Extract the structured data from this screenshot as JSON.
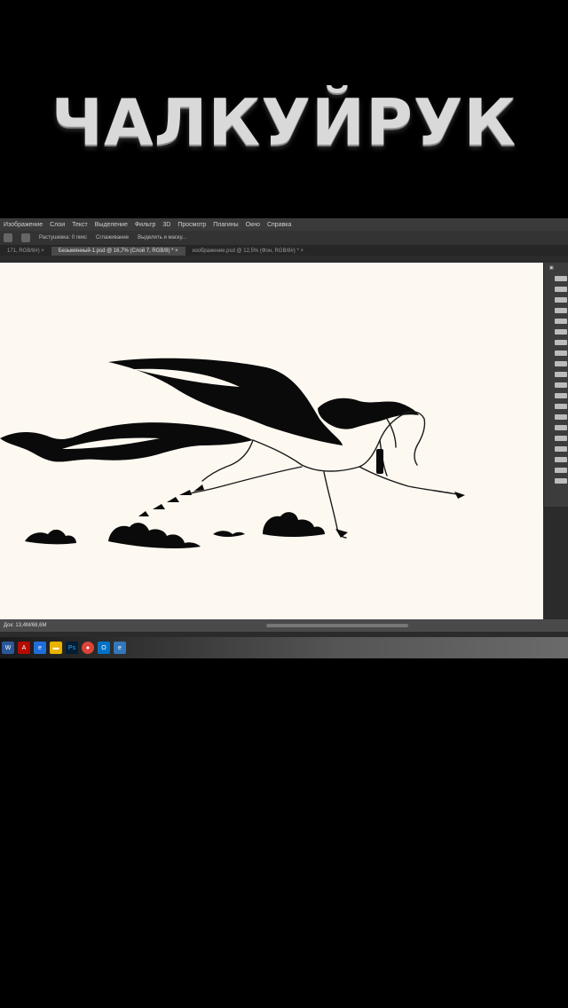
{
  "video_title": "ЧАЛКУЙРУК",
  "app": {
    "menu": [
      "Изображение",
      "Слои",
      "Текст",
      "Выделение",
      "Фильтр",
      "3D",
      "Просмотр",
      "Плагины",
      "Окно",
      "Справка"
    ],
    "options": {
      "label1": "Растушевка: 0 пикс",
      "label2": "Сглаживание",
      "label3": "Выделить и маску..."
    },
    "tabs": [
      {
        "label": "171, RGB/8#) ×",
        "active": false
      },
      {
        "label": "Безымянный-1.psd @ 16,7% (Слой 7, RGB/8) * ×",
        "active": true
      },
      {
        "label": "изображение.psd @ 12,5% (Фон, RGB/8#) * ×",
        "active": false
      }
    ],
    "status": "Док: 13,4М/68,6М"
  },
  "colors": {
    "canvas": "#fdf9f1",
    "ink": "#0a0a0a",
    "title": "#d9d9d9",
    "app_bg": "#2b2b2b"
  },
  "taskbar_icons": [
    "word-icon",
    "acrobat-icon",
    "explorer-icon",
    "folder-icon",
    "photoshop-icon",
    "chrome-icon",
    "outlook-icon",
    "edge-icon"
  ]
}
